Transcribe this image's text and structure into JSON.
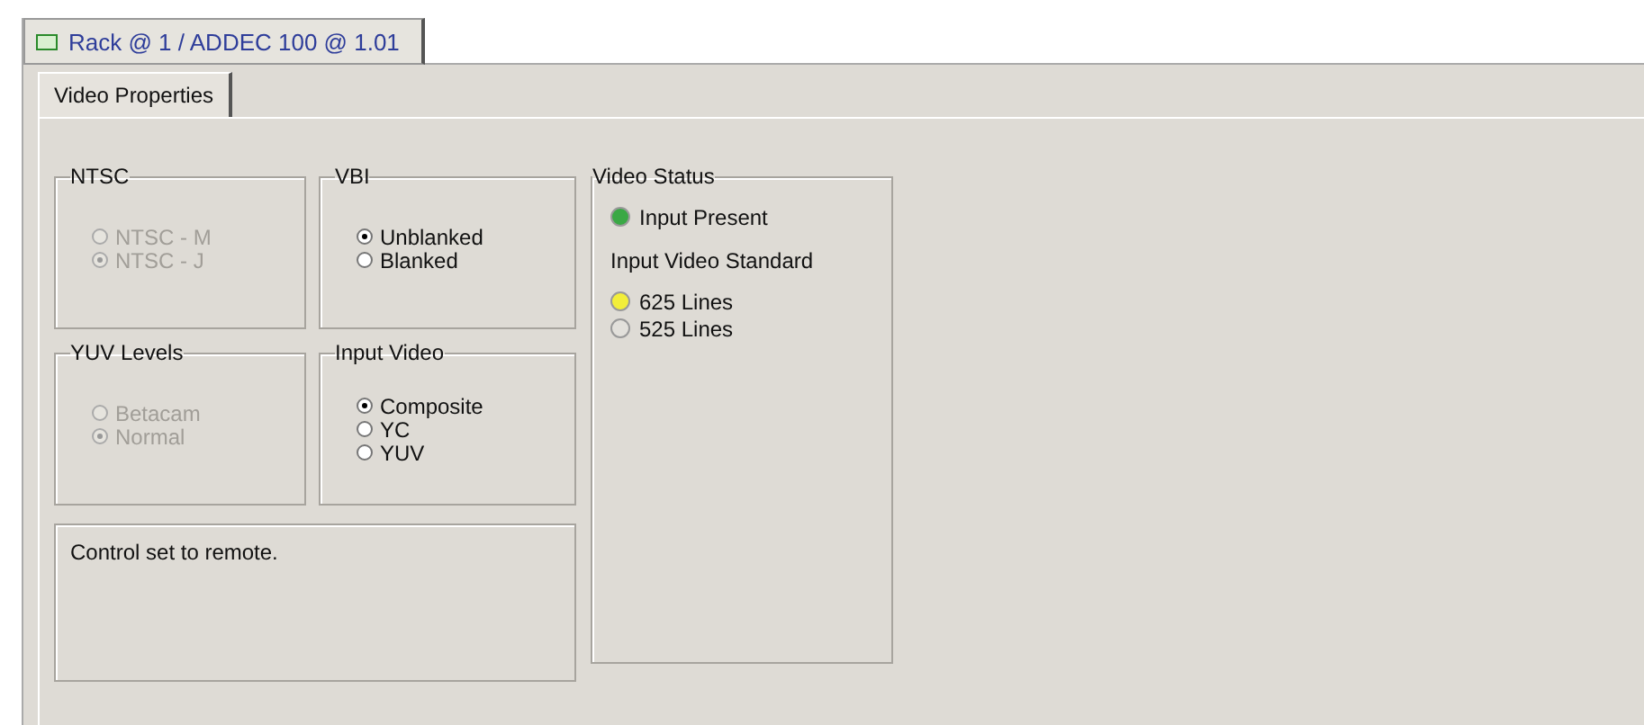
{
  "document_tab": {
    "title": "Rack @ 1 / ADDEC 100 @ 1.01",
    "selected": true
  },
  "tabs": [
    {
      "label": "Video Properties",
      "selected": true
    }
  ],
  "groups": [
    {
      "title": "NTSC",
      "disabled": true,
      "options": [
        {
          "label": "NTSC - M",
          "selected": false
        },
        {
          "label": "NTSC - J",
          "selected": true
        }
      ]
    },
    {
      "title": "VBI",
      "disabled": false,
      "options": [
        {
          "label": "Unblanked",
          "selected": true
        },
        {
          "label": "Blanked",
          "selected": false
        }
      ]
    },
    {
      "title": "YUV Levels",
      "disabled": true,
      "options": [
        {
          "label": "Betacam",
          "selected": false
        },
        {
          "label": "Normal",
          "selected": true
        }
      ]
    },
    {
      "title": "Input Video",
      "disabled": false,
      "options": [
        {
          "label": "Composite",
          "selected": true
        },
        {
          "label": "YC",
          "selected": false
        },
        {
          "label": "YUV",
          "selected": false
        }
      ]
    }
  ],
  "message": "Control set to remote.",
  "video_status": {
    "title": "Video Status",
    "input": {
      "label": "Input Present",
      "on": true,
      "color": "#3aa845"
    },
    "standard_label": "Input Video Standard",
    "standards": [
      {
        "label": "625 Lines",
        "on": true,
        "color": "#f2ee3a"
      },
      {
        "label": "525 Lines",
        "on": false
      }
    ]
  }
}
